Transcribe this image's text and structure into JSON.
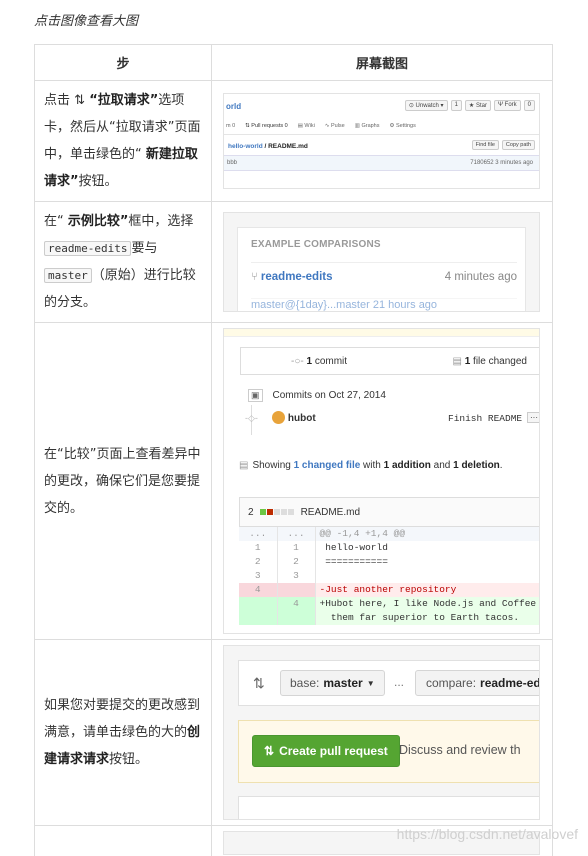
{
  "caption": "点击图像查看大图",
  "table": {
    "header_step": "步",
    "header_screenshot": "屏幕截图"
  },
  "rows": [
    {
      "t1": "点击 ",
      "b1": "“拉取请求”",
      "t2": "选项卡，然后从“拉取请求”页面中，单击绿色的“ ",
      "b2": "新建拉取请求”",
      "t3": "按钮。"
    },
    {
      "t1": "在“ ",
      "b1": "示例比较”",
      "t2": "框中，选择",
      "code1": "readme-edits",
      "t3": "要与",
      "code2": "master",
      "t4": "（原始）进行比较的分支。"
    },
    {
      "text": "在“比较”页面上查看差异中的更改，确保它们是您要提交的。"
    },
    {
      "t1": "如果您对要提交的更改感到满意，请单击绿色的大的",
      "b1": "创建请求请求",
      "t2": "按钮。"
    }
  ],
  "shot1": {
    "repo": "orld",
    "unwatch": "⊙ Unwatch ▾",
    "unwatch_count": "1",
    "star": "★ Star",
    "fork": "Ψ Fork",
    "fork_count": "0",
    "tab_code": "m  0",
    "tab_pr": "⇅ Pull requests  0",
    "tab_wiki": "▤ Wiki",
    "tab_pulse": "∿ Pulse",
    "tab_graphs": "▥ Graphs",
    "tab_settings": "⚙ Settings",
    "crumb_link": "hello-world",
    "crumb_rest": " / README.md",
    "find_file": "Find file",
    "copy_path": "Copy path",
    "bar_left": "bbb",
    "bar_right": "7180652  3 minutes ago"
  },
  "shot2": {
    "heading": "EXAMPLE COMPARISONS",
    "branch": "readme-edits",
    "time": "4 minutes ago",
    "row2": "master@{1day}...master          21 hours ago"
  },
  "shot3": {
    "commits_count": "1",
    "commits_label": " commit",
    "files_count": "1",
    "files_label": " file changed",
    "commits_on": "Commits on Oct 27, 2014",
    "author": "hubot",
    "message": "Finish README",
    "more": "···",
    "showing": "Showing ",
    "changed_file": "1 changed file",
    "with": " with ",
    "addition": "1 addition",
    "and": " and ",
    "deletion": "1 deletion",
    "period": ".",
    "diff_count": "2",
    "file_name": "README.md",
    "diff_lines": [
      {
        "kind": "hh",
        "a": "...",
        "b": "...",
        "text": "@@ -1,4 +1,4 @@"
      },
      {
        "kind": "ctx",
        "a": "1",
        "b": "1",
        "text": " hello-world"
      },
      {
        "kind": "ctx",
        "a": "2",
        "b": "2",
        "text": " ==========="
      },
      {
        "kind": "ctx",
        "a": "3",
        "b": "3",
        "text": ""
      },
      {
        "kind": "del",
        "a": "4",
        "b": "",
        "text": "-Just another repository"
      },
      {
        "kind": "add",
        "a": "",
        "b": "4",
        "text": "+Hubot here, I like Node.js and Coffee"
      },
      {
        "kind": "add",
        "a": "",
        "b": "",
        "text": "  them far superior to Earth tacos."
      }
    ]
  },
  "shot4": {
    "base_label": "base:",
    "base_branch": "master",
    "ellipsis": "...",
    "compare_label": "compare:",
    "compare_branch": "readme-ed",
    "create_button": "Create pull request",
    "discuss": "Discuss and review th"
  },
  "watermark": "https://blog.csdn.net/avalovef",
  "colors": {
    "link": "#4078c0",
    "green_button": "#55a532",
    "del_bg": "#ffecec",
    "add_bg": "#eaffea"
  }
}
